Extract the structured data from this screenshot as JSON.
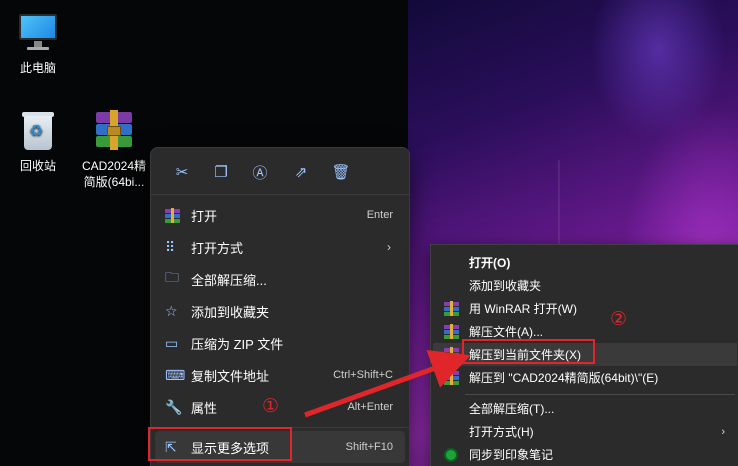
{
  "desktop": {
    "icons": [
      {
        "label": "此电脑",
        "icon": "computer-icon"
      },
      {
        "label": "回收站",
        "icon": "recycle-bin-icon"
      },
      {
        "label_line1": "CAD2024精",
        "label_line2": "简版(64bi...",
        "icon": "winrar-archive-icon"
      }
    ]
  },
  "win11_menu": {
    "toolbar": [
      "cut-icon",
      "copy-icon",
      "rename-icon",
      "share-icon",
      "delete-icon"
    ],
    "items": [
      {
        "label": "打开",
        "shortcut": "Enter",
        "icon": "winrar-icon"
      },
      {
        "label": "打开方式",
        "shortcut": "",
        "icon": "open-with-icon",
        "submenu": true
      },
      {
        "label": "全部解压缩...",
        "shortcut": "",
        "icon": "extract-all-icon"
      },
      {
        "label": "添加到收藏夹",
        "shortcut": "",
        "icon": "star-icon"
      },
      {
        "label": "压缩为 ZIP 文件",
        "shortcut": "",
        "icon": "zip-icon"
      },
      {
        "label": "复制文件地址",
        "shortcut": "Ctrl+Shift+C",
        "icon": "copy-path-icon"
      },
      {
        "label": "属性",
        "shortcut": "Alt+Enter",
        "icon": "wrench-icon"
      },
      {
        "label": "显示更多选项",
        "shortcut": "Shift+F10",
        "icon": "more-options-icon"
      }
    ]
  },
  "classic_menu": {
    "items": [
      {
        "label": "打开(O)",
        "bold": true
      },
      {
        "label": "添加到收藏夹"
      },
      {
        "label": "用 WinRAR 打开(W)",
        "icon": "winrar-icon"
      },
      {
        "label": "解压文件(A)...",
        "icon": "winrar-icon"
      },
      {
        "label": "解压到当前文件夹(X)",
        "icon": "winrar-icon"
      },
      {
        "label": "解压到 \"CAD2024精简版(64bit)\\\"(E)",
        "icon": "winrar-icon"
      },
      {
        "label": "全部解压缩(T)..."
      },
      {
        "label": "打开方式(H)",
        "submenu": true
      },
      {
        "label": "同步到印象笔记",
        "icon": "evernote-icon"
      }
    ]
  },
  "annotations": {
    "step1": "①",
    "step2": "②",
    "color": "#e0262a"
  }
}
